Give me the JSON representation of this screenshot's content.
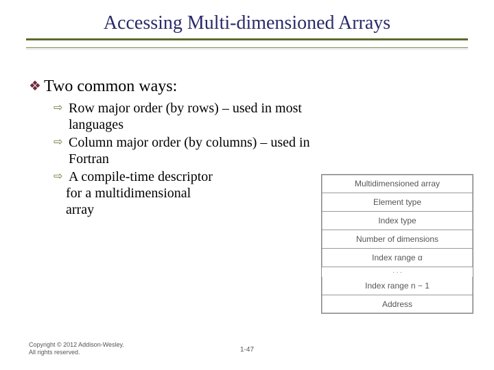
{
  "title": "Accessing Multi-dimensioned Arrays",
  "main_point": "Two common ways:",
  "sub_points": [
    "Row major order (by rows) – used in most languages",
    "Column major order (by columns) – used in Fortran",
    "A compile-time descriptor"
  ],
  "continuation_lines": [
    "for a multidimensional",
    "array"
  ],
  "descriptor_rows": [
    "Multidimensioned array",
    "Element type",
    "Index type",
    "Number of dimensions",
    "Index range α"
  ],
  "descriptor_gap_label": "·  ·  ·",
  "descriptor_tail": [
    "Index range n − 1",
    "Address"
  ],
  "copyright": "Copyright © 2012 Addison-Wesley. All rights reserved.",
  "slide_number": "1-47",
  "glyphs": {
    "diamond": "❖",
    "arrow": "⇨"
  }
}
